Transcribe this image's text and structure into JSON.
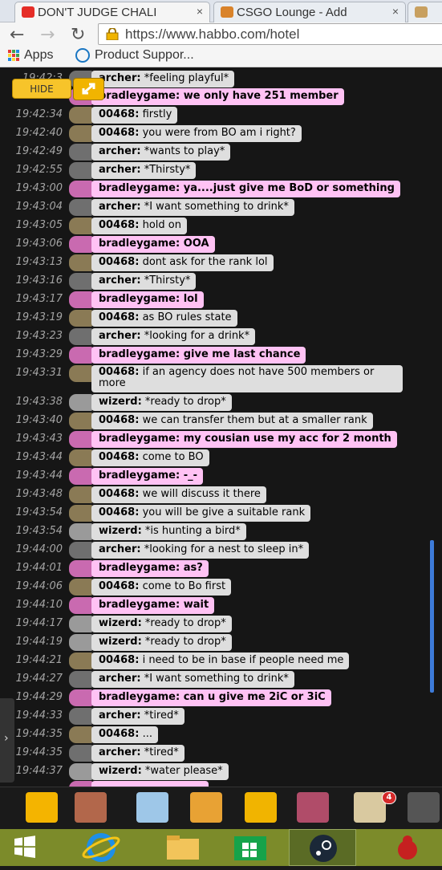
{
  "browser": {
    "tabs": [
      {
        "label": "DON'T JUDGE CHALI",
        "close": "×"
      },
      {
        "label": "CSGO Lounge - Add",
        "close": "×"
      }
    ],
    "url": "https://www.habbo.com/hotel",
    "bookmarks": [
      "Apps",
      "Product Suppor..."
    ]
  },
  "controls": {
    "hide_label": "HIDE",
    "handle_arrow": "›"
  },
  "messages": [
    {
      "time": "19:42:34",
      "user": "00468:",
      "text": "firstly",
      "style": "gray",
      "avatar": "#8a7a55"
    },
    {
      "time": "19:42:40",
      "user": "00468:",
      "text": "you were from BO am i right?",
      "style": "gray",
      "avatar": "#8a7a55"
    },
    {
      "time": "19:42:49",
      "user": "archer:",
      "text": "*wants to play*",
      "style": "gray",
      "avatar": "#6f6f6f"
    },
    {
      "time": "19:42:55",
      "user": "archer:",
      "text": "*Thirsty*",
      "style": "gray",
      "avatar": "#6f6f6f"
    },
    {
      "time": "19:43:00",
      "user": "bradleygame:",
      "text": "ya....just give me BoD or something",
      "style": "pink",
      "avatar": "#c96ab0"
    },
    {
      "time": "19:43:04",
      "user": "archer:",
      "text": "*I want something to drink*",
      "style": "gray",
      "avatar": "#6f6f6f"
    },
    {
      "time": "19:43:05",
      "user": "00468:",
      "text": "hold on",
      "style": "gray",
      "avatar": "#8a7a55"
    },
    {
      "time": "19:43:06",
      "user": "bradleygame:",
      "text": "OOA",
      "style": "pink",
      "avatar": "#c96ab0"
    },
    {
      "time": "19:43:13",
      "user": "00468:",
      "text": "dont ask for the rank lol",
      "style": "gray",
      "avatar": "#8a7a55"
    },
    {
      "time": "19:43:16",
      "user": "archer:",
      "text": "*Thirsty*",
      "style": "gray",
      "avatar": "#6f6f6f"
    },
    {
      "time": "19:43:17",
      "user": "bradleygame:",
      "text": "lol",
      "style": "pink",
      "avatar": "#c96ab0"
    },
    {
      "time": "19:43:19",
      "user": "00468:",
      "text": "as BO rules state",
      "style": "gray",
      "avatar": "#8a7a55"
    },
    {
      "time": "19:43:23",
      "user": "archer:",
      "text": "*looking for a drink*",
      "style": "gray",
      "avatar": "#6f6f6f"
    },
    {
      "time": "19:43:29",
      "user": "bradleygame:",
      "text": "give me last chance",
      "style": "pink",
      "avatar": "#c96ab0"
    },
    {
      "time": "19:43:31",
      "user": "00468:",
      "text": "if an agency does not have 500 members or more",
      "style": "gray",
      "avatar": "#8a7a55",
      "tall": true
    },
    {
      "time": "19:43:38",
      "user": "wizerd:",
      "text": "*ready to drop*",
      "style": "gray",
      "avatar": "#9a9a9a"
    },
    {
      "time": "19:43:40",
      "user": "00468:",
      "text": "we can transfer them but at a smaller rank",
      "style": "gray",
      "avatar": "#8a7a55"
    },
    {
      "time": "19:43:43",
      "user": "bradleygame:",
      "text": "my cousian use my acc for 2 month",
      "style": "pink",
      "avatar": "#c96ab0"
    },
    {
      "time": "19:43:44",
      "user": "00468:",
      "text": "come to BO",
      "style": "gray",
      "avatar": "#8a7a55"
    },
    {
      "time": "19:43:44",
      "user": "bradleygame:",
      "text": "-_-",
      "style": "pink",
      "avatar": "#c96ab0"
    },
    {
      "time": "19:43:48",
      "user": "00468:",
      "text": "we will discuss it there",
      "style": "gray",
      "avatar": "#8a7a55"
    },
    {
      "time": "19:43:54",
      "user": "00468:",
      "text": "you will be give a suitable rank",
      "style": "gray",
      "avatar": "#8a7a55"
    },
    {
      "time": "19:43:54",
      "user": "wizerd:",
      "text": "*is hunting a bird*",
      "style": "gray",
      "avatar": "#9a9a9a"
    },
    {
      "time": "19:44:00",
      "user": "archer:",
      "text": "*looking for a nest to sleep in*",
      "style": "gray",
      "avatar": "#6f6f6f"
    },
    {
      "time": "19:44:01",
      "user": "bradleygame:",
      "text": "as?",
      "style": "pink",
      "avatar": "#c96ab0"
    },
    {
      "time": "19:44:06",
      "user": "00468:",
      "text": "come to Bo first",
      "style": "gray",
      "avatar": "#8a7a55"
    },
    {
      "time": "19:44:10",
      "user": "bradleygame:",
      "text": "wait",
      "style": "pink",
      "avatar": "#c96ab0"
    },
    {
      "time": "19:44:17",
      "user": "wizerd:",
      "text": "*ready to drop*",
      "style": "gray",
      "avatar": "#9a9a9a"
    },
    {
      "time": "19:44:19",
      "user": "wizerd:",
      "text": "*ready to drop*",
      "style": "gray",
      "avatar": "#9a9a9a"
    },
    {
      "time": "19:44:21",
      "user": "00468:",
      "text": "i need to be in base if people need me",
      "style": "gray",
      "avatar": "#8a7a55"
    },
    {
      "time": "19:44:27",
      "user": "archer:",
      "text": "*I want something to drink*",
      "style": "gray",
      "avatar": "#6f6f6f"
    },
    {
      "time": "19:44:29",
      "user": "bradleygame:",
      "text": "can u give me 2iC or 3iC",
      "style": "pink",
      "avatar": "#c96ab0"
    },
    {
      "time": "19:44:33",
      "user": "archer:",
      "text": "*tired*",
      "style": "gray",
      "avatar": "#6f6f6f"
    },
    {
      "time": "19:44:35",
      "user": "00468:",
      "text": "...",
      "style": "gray",
      "avatar": "#8a7a55"
    },
    {
      "time": "19:44:35",
      "user": "archer:",
      "text": "*tired*",
      "style": "gray",
      "avatar": "#6f6f6f"
    },
    {
      "time": "19:44:37",
      "user": "wizerd:",
      "text": "*water please*",
      "style": "gray",
      "avatar": "#9a9a9a"
    }
  ],
  "partial_top": [
    {
      "user": "archer:",
      "text": "*feeling playful*",
      "style": "gray"
    },
    {
      "user": "bradleygame:",
      "text": "we only have 251 member",
      "style": "pink"
    }
  ],
  "toolbar_badge": "4",
  "icons": [
    "habbo-home-icon",
    "rooms-icon",
    "quests-icon",
    "shop-icon",
    "builder-icon",
    "inventory-icon",
    "friends-icon",
    "camera-icon"
  ],
  "taskbar": [
    "windows-start-icon",
    "internet-explorer-icon",
    "file-explorer-icon",
    "store-icon",
    "steam-icon",
    "app-icon"
  ]
}
